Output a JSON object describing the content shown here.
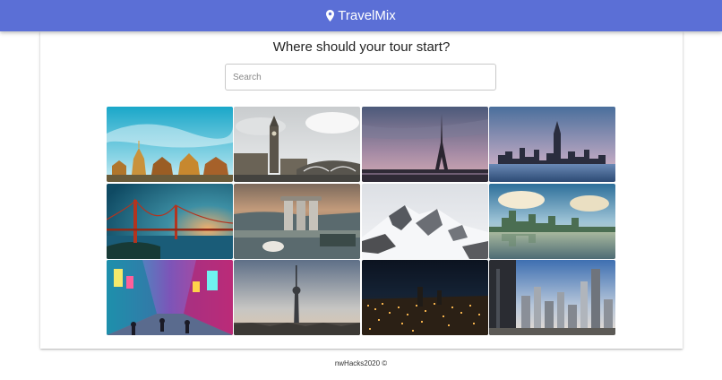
{
  "header": {
    "title": "TravelMix",
    "icon": "map-marker-icon",
    "background": "#5b6fd6"
  },
  "main": {
    "heading": "Where should your tour start?",
    "search": {
      "placeholder": "Search",
      "value": ""
    },
    "destinations": [
      {
        "id": "bangkok",
        "icon": "temple-skyline-photo"
      },
      {
        "id": "london",
        "icon": "big-ben-photo"
      },
      {
        "id": "paris",
        "icon": "eiffel-tower-photo"
      },
      {
        "id": "new-york",
        "icon": "manhattan-skyline-photo"
      },
      {
        "id": "san-francisco",
        "icon": "golden-gate-bridge-photo"
      },
      {
        "id": "singapore",
        "icon": "marina-bay-photo"
      },
      {
        "id": "alps",
        "icon": "snowy-mountain-photo"
      },
      {
        "id": "vancouver",
        "icon": "harbour-skyline-photo"
      },
      {
        "id": "tokyo",
        "icon": "neon-street-photo"
      },
      {
        "id": "berlin",
        "icon": "tv-tower-photo"
      },
      {
        "id": "night-city",
        "icon": "night-cityscape-photo"
      },
      {
        "id": "beijing",
        "icon": "high-rise-skyline-photo"
      }
    ]
  },
  "footer": {
    "text": "nwHacks2020 ©"
  }
}
